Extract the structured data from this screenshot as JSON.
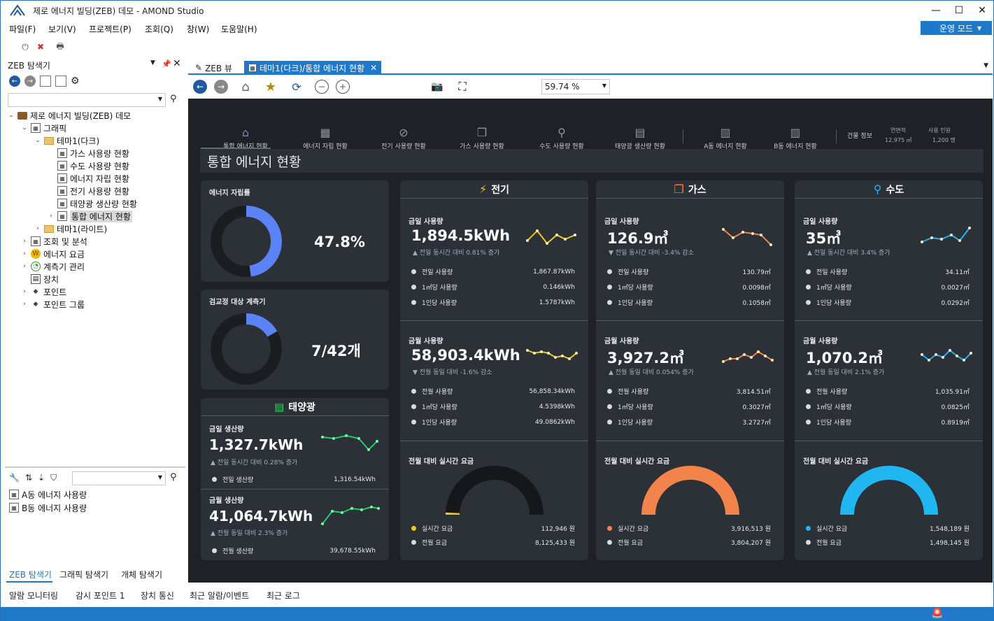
{
  "window": {
    "title": "제로 에너지 빌딩(ZEB) 데모 - AMOND Studio"
  },
  "menu": [
    "파일(F)",
    "보기(V)",
    "프로젝트(P)",
    "조회(Q)",
    "창(W)",
    "도움말(H)"
  ],
  "mode_button": "운영 모드",
  "explorer": {
    "title": "ZEB 탐색기",
    "tree": [
      {
        "label": "제로 에너지 빌딩(ZEB) 데모",
        "level": 0,
        "arrow": "⌄",
        "icon": "briefcase"
      },
      {
        "label": "그래픽",
        "level": 1,
        "arrow": "⌄",
        "icon": "graphic"
      },
      {
        "label": "테마1(다크)",
        "level": 2,
        "arrow": "⌄",
        "icon": "folder"
      },
      {
        "label": "가스 사용량 현황",
        "level": 3,
        "arrow": "",
        "icon": "doc"
      },
      {
        "label": "수도 사용량 현황",
        "level": 3,
        "arrow": "",
        "icon": "doc"
      },
      {
        "label": "에너지 자립 현황",
        "level": 3,
        "arrow": "",
        "icon": "doc"
      },
      {
        "label": "전기 사용량 현황",
        "level": 3,
        "arrow": "",
        "icon": "doc"
      },
      {
        "label": "태양광 생산량 현황",
        "level": 3,
        "arrow": "",
        "icon": "doc"
      },
      {
        "label": "통합 에너지 현황",
        "level": 3,
        "arrow": "›",
        "icon": "doc",
        "selected": true
      },
      {
        "label": "테마1(라이트)",
        "level": 2,
        "arrow": "›",
        "icon": "folder"
      },
      {
        "label": "조회 및 분석",
        "level": 1,
        "arrow": "›",
        "icon": "doc"
      },
      {
        "label": "에너지 요금",
        "level": 1,
        "arrow": "›",
        "icon": "coin"
      },
      {
        "label": "계측기 관리",
        "level": 1,
        "arrow": "›",
        "icon": "meter"
      },
      {
        "label": "장치",
        "level": 1,
        "arrow": "",
        "icon": "device"
      },
      {
        "label": "포인트",
        "level": 1,
        "arrow": "›",
        "icon": "tag"
      },
      {
        "label": "포인트 그룹",
        "level": 1,
        "arrow": "›",
        "icon": "tag"
      }
    ],
    "lower_list": [
      "A동 에너지 사용량",
      "B동 에너지 사용량"
    ],
    "bottom_tabs": [
      "ZEB 탐색기",
      "그래픽 탐색기",
      "개체 탐색기"
    ]
  },
  "status_tabs": [
    "알람 모니터링",
    "감시 포인트 1",
    "장치 통신",
    "최근 알람/이벤트",
    "최근 로그"
  ],
  "doc_tabs": [
    {
      "label": "ZEB 뷰",
      "active": false
    },
    {
      "label": "테마1(다크)/통합 에너지 현황",
      "active": true
    }
  ],
  "zoom": "59.74 %",
  "dashboard": {
    "nav": [
      "통합 에너지 현황",
      "에너지 자립 현황",
      "전기 사용량 현황",
      "가스 사용량 현황",
      "수도 사용량 현황",
      "태양광 생산량 현황",
      "A동 에너지 현황",
      "B동 에너지 현황"
    ],
    "building_info": {
      "label": "건물 정보",
      "area_label": "연면적",
      "area_value": "12,975 ㎡",
      "people_label": "사용 인원",
      "people_value": "1,200 명"
    },
    "title": "통합 에너지 현황",
    "self_sufficiency": {
      "label": "에너지 자립률",
      "value": "47.8%",
      "fraction": 0.478
    },
    "calibration": {
      "label": "검교정 대상 계측기",
      "value": "7/42개",
      "fraction": 0.1667
    },
    "solar": {
      "title": "태양광",
      "today_label": "금일 생산량",
      "today_value": "1,327.7kWh",
      "today_change": "▲ 전일 동시간 대비 0.28% 증가",
      "today_row_label": "전일 생산량",
      "today_row_value": "1,316.54kWh",
      "month_label": "금월 생산량",
      "month_value": "41,064.7kWh",
      "month_change": "▲ 전월 동일 대비 2.3% 증가",
      "month_row_label": "전월 생산량",
      "month_row_value": "39,678.55kWh"
    },
    "columns": [
      {
        "key": "elec",
        "title": "전기",
        "color": "#f2c81c",
        "today_label": "금일 사용량",
        "today_value": "1,894.5kWh",
        "today_change": "▲ 전일 동시간 대비 0.81% 증가",
        "today_rows": [
          {
            "label": "전일 사용량",
            "value": "1,867.87kWh"
          },
          {
            "label": "1㎡당 사용량",
            "value": "0.146kWh"
          },
          {
            "label": "1인당 사용량",
            "value": "1.5787kWh"
          }
        ],
        "month_label": "금월 사용량",
        "month_value": "58,903.4kWh",
        "month_change": "▼ 전월 동일 대비 -1.6% 감소",
        "month_rows": [
          {
            "label": "전월 사용량",
            "value": "56,858.34kWh"
          },
          {
            "label": "1㎡당 사용량",
            "value": "4.5398kWh"
          },
          {
            "label": "1인당 사용량",
            "value": "49.0862kWh"
          }
        ],
        "fee_label": "전월 대비 실시간 요금",
        "fee_rows": [
          {
            "label": "실시간 요금",
            "value": "112,946 원"
          },
          {
            "label": "전월 요금",
            "value": "8,125,433 원"
          }
        ],
        "fee_fraction": 0.014
      },
      {
        "key": "gas",
        "title": "가스",
        "color": "#f2834a",
        "today_label": "금일 사용량",
        "today_value": "126.9㎥",
        "today_change": "▼ 전일 동시간 대비 -3.4% 감소",
        "today_rows": [
          {
            "label": "전일 사용량",
            "value": "130.79㎥"
          },
          {
            "label": "1㎡당 사용량",
            "value": "0.0098㎥"
          },
          {
            "label": "1인당 사용량",
            "value": "0.1058㎥"
          }
        ],
        "month_label": "금월 사용량",
        "month_value": "3,927.2㎥",
        "month_change": "▲ 전월 동일 대비 0.054% 증가",
        "month_rows": [
          {
            "label": "전월 사용량",
            "value": "3,814.51㎥"
          },
          {
            "label": "1㎡당 사용량",
            "value": "0.3027㎥"
          },
          {
            "label": "1인당 사용량",
            "value": "3.2727㎥"
          }
        ],
        "fee_label": "전월 대비 실시간 요금",
        "fee_rows": [
          {
            "label": "실시간 요금",
            "value": "3,916,513 원"
          },
          {
            "label": "전월 요금",
            "value": "3,804,207 원"
          }
        ],
        "fee_fraction": 1.0
      },
      {
        "key": "water",
        "title": "수도",
        "color": "#1fb6f2",
        "today_label": "금일 사용량",
        "today_value": "35㎥",
        "today_change": "▲ 전일 동시간 대비 3.4% 증가",
        "today_rows": [
          {
            "label": "전일 사용량",
            "value": "34.11㎥"
          },
          {
            "label": "1㎡당 사용량",
            "value": "0.0027㎥"
          },
          {
            "label": "1인당 사용량",
            "value": "0.0292㎥"
          }
        ],
        "month_label": "금월 사용량",
        "month_value": "1,070.2㎥",
        "month_change": "▲ 전월 동일 대비 2.1% 증가",
        "month_rows": [
          {
            "label": "전월 사용량",
            "value": "1,035.91㎥"
          },
          {
            "label": "1㎡당 사용량",
            "value": "0.0825㎥"
          },
          {
            "label": "1인당 사용량",
            "value": "0.8919㎥"
          }
        ],
        "fee_label": "전월 대비 실시간 요금",
        "fee_rows": [
          {
            "label": "실시간 요금",
            "value": "1,548,189 원"
          },
          {
            "label": "전월 요금",
            "value": "1,498,145 원"
          }
        ],
        "fee_fraction": 1.0
      }
    ]
  }
}
